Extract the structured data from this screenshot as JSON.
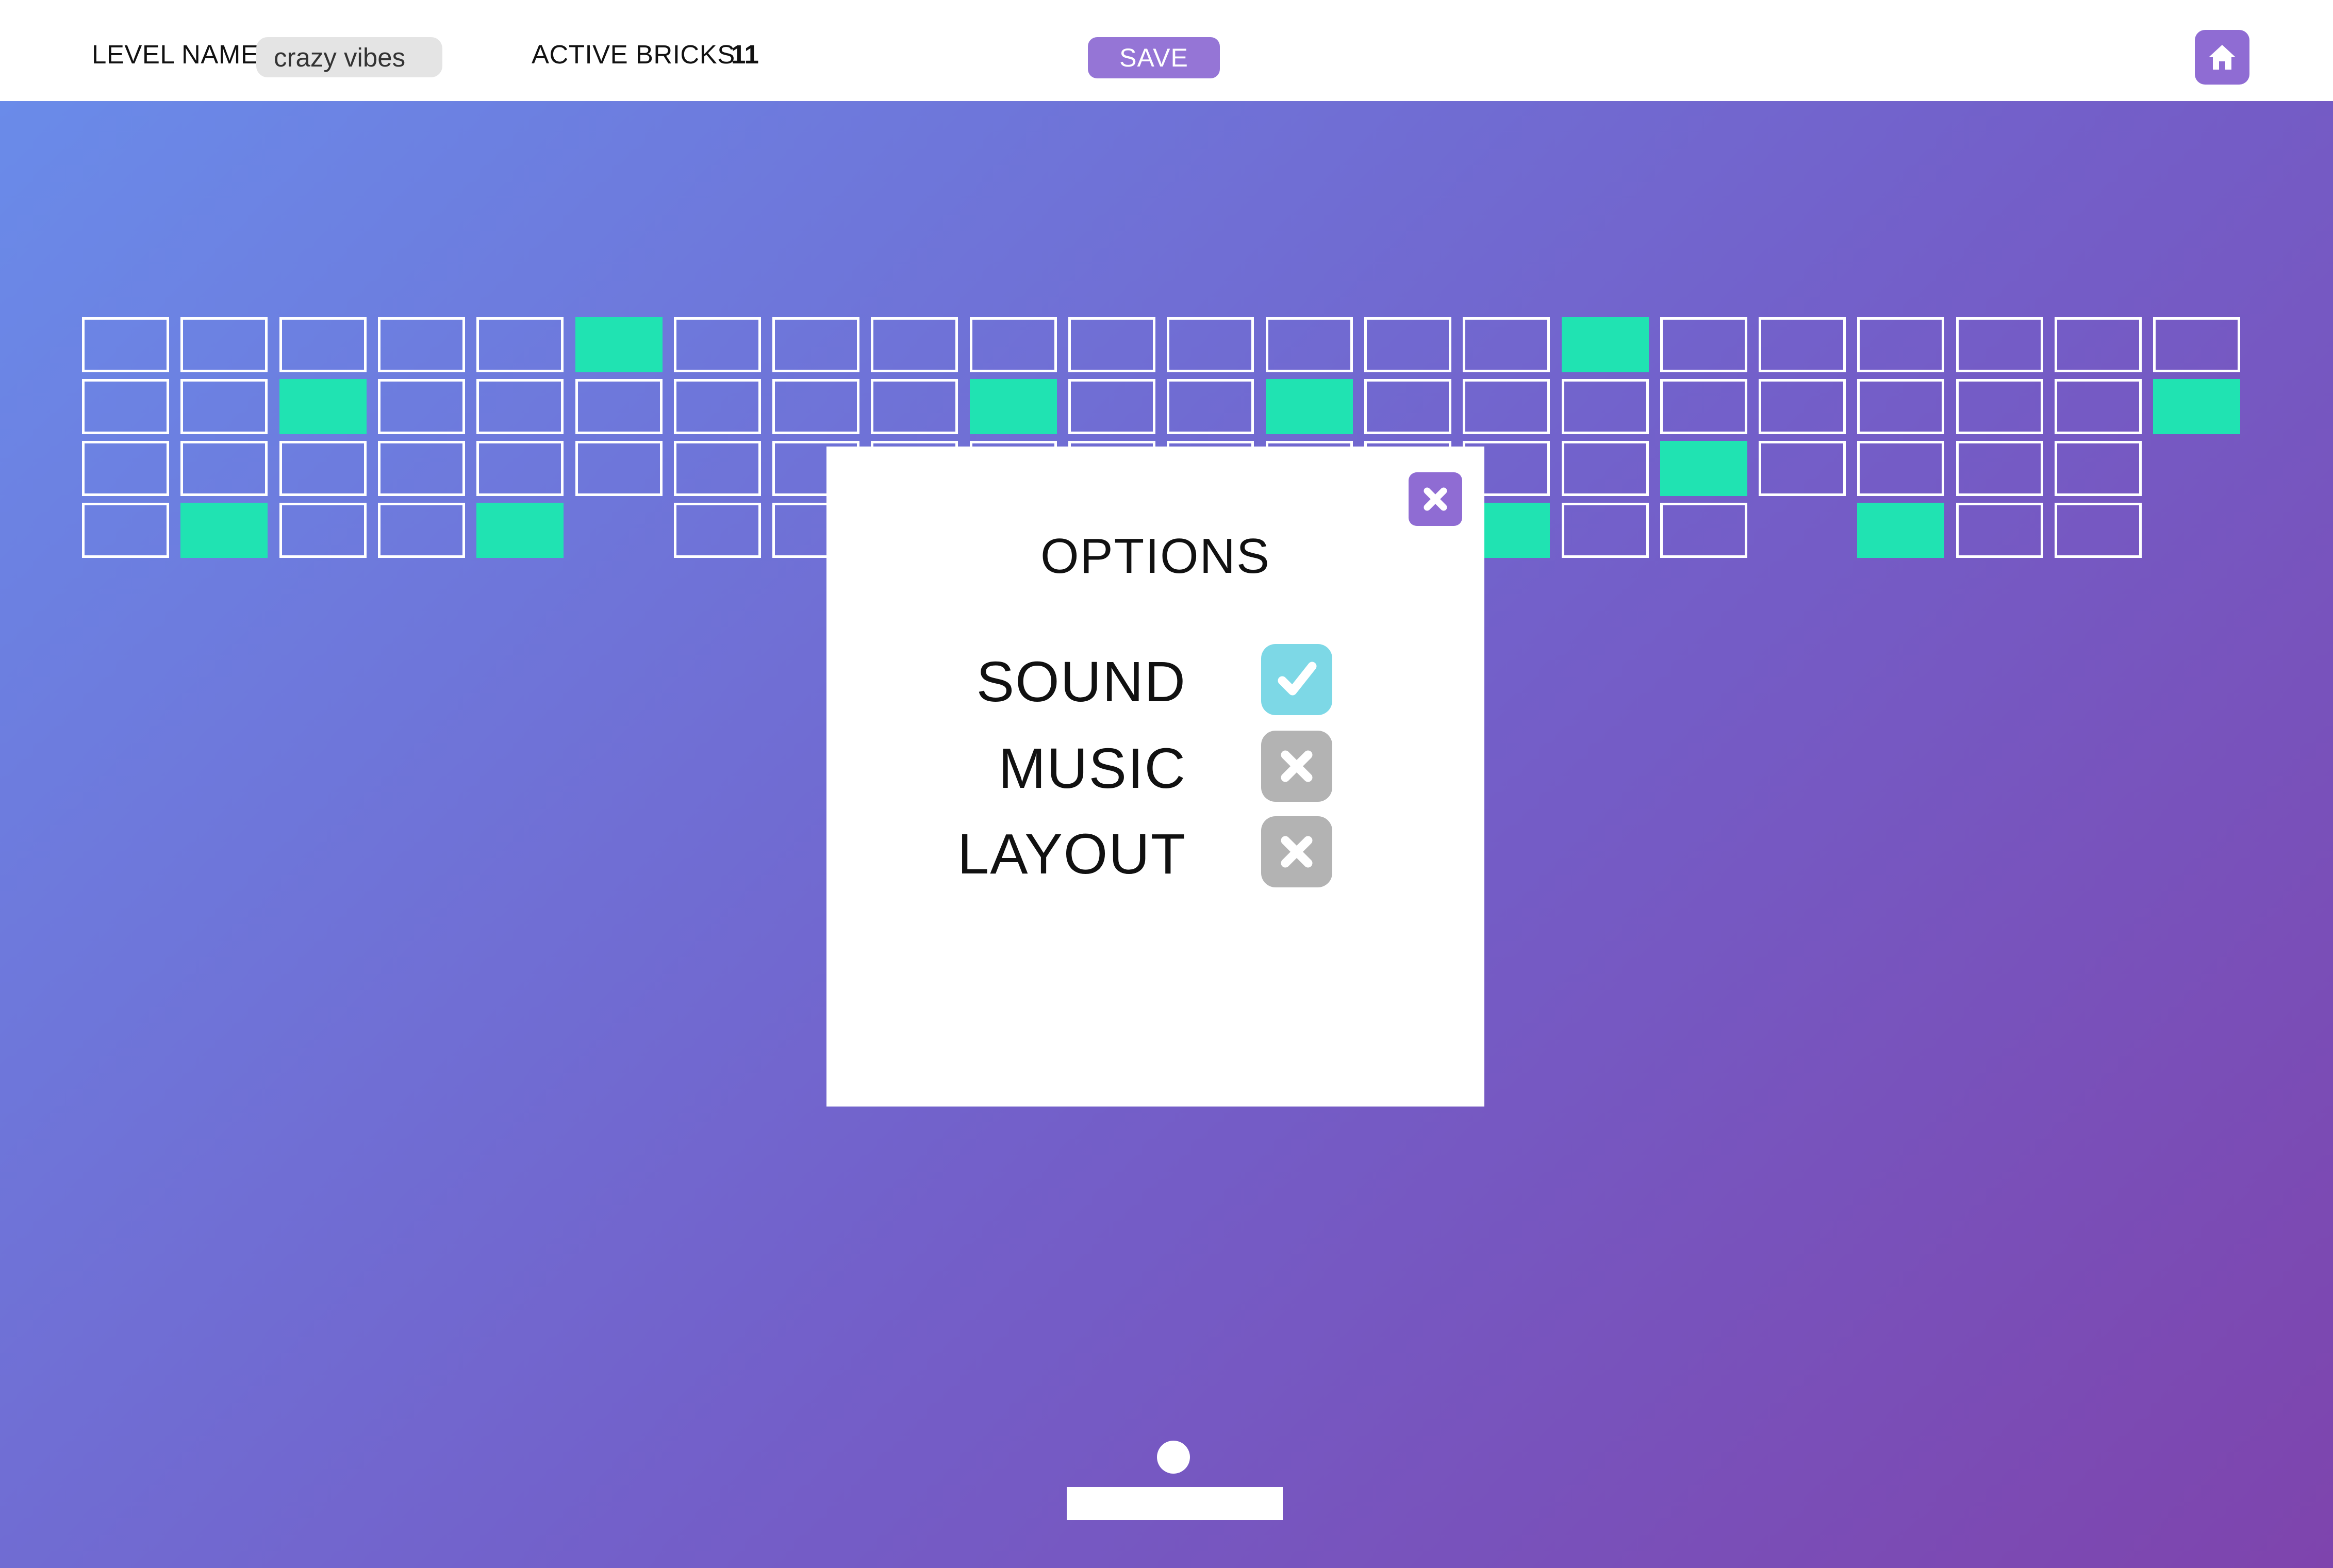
{
  "topbar": {
    "level_name_label": "LEVEL NAME",
    "level_name_value": "crazy vibes",
    "active_bricks_label": "ACTIVE BRICKS",
    "active_bricks_count": "11",
    "save_label": "SAVE",
    "home_icon": "home-icon"
  },
  "board": {
    "rows": [
      [
        0,
        0,
        0,
        0,
        0,
        1,
        0,
        0,
        0,
        0,
        0,
        0,
        0,
        0,
        0,
        1,
        0,
        0,
        0,
        0,
        0,
        0
      ],
      [
        0,
        0,
        1,
        0,
        0,
        0,
        0,
        0,
        0,
        1,
        0,
        0,
        1,
        0,
        0,
        0,
        0,
        0,
        0,
        0,
        0,
        1
      ],
      [
        0,
        0,
        0,
        0,
        0,
        0,
        0,
        0,
        0,
        0,
        0,
        0,
        0,
        0,
        0,
        0,
        1,
        0,
        0,
        0,
        0,
        null
      ],
      [
        0,
        1,
        0,
        0,
        1,
        null,
        0,
        0,
        0,
        0,
        null,
        0,
        0,
        0,
        1,
        0,
        0,
        null,
        1,
        0,
        0,
        null
      ]
    ]
  },
  "options": {
    "title": "OPTIONS",
    "close_icon": "close-icon",
    "items": [
      {
        "label": "SOUND",
        "enabled": true
      },
      {
        "label": "MUSIC",
        "enabled": false
      },
      {
        "label": "LAYOUT",
        "enabled": false
      }
    ]
  },
  "colors": {
    "accent_purple": "#8f6cd3",
    "active_brick": "#20e3b2",
    "toggle_on": "#7dd8e6",
    "toggle_off": "#b3b3b3"
  }
}
